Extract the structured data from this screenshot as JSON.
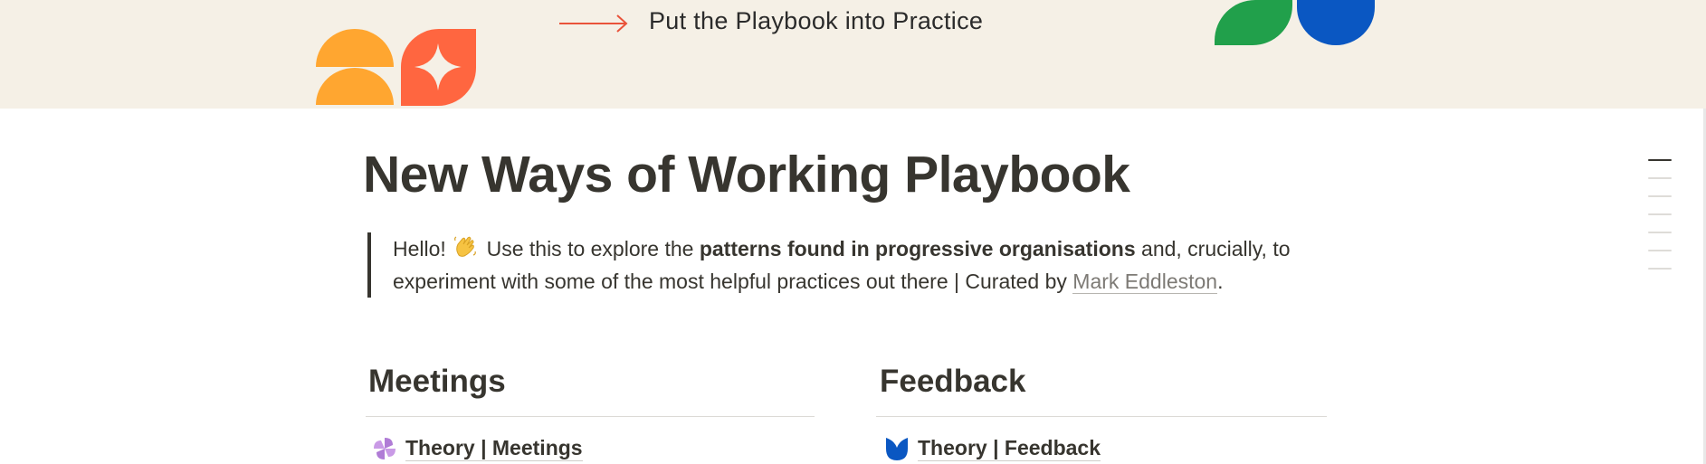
{
  "cover": {
    "cta_text": "Put the Playbook into Practice",
    "colors": {
      "orange": "#ffa630",
      "coral": "#ff6640",
      "green": "#21a04b",
      "blue": "#0a57c2",
      "accent_arrow": "#e9533a",
      "background": "#f5f0e6"
    }
  },
  "page": {
    "title": "New Ways of Working Playbook"
  },
  "intro": {
    "greeting": "Hello!",
    "wave_icon": "waving-hand-icon",
    "text_before": "Use this to explore the",
    "bold_text": "patterns found in progressive organisations",
    "text_after": "and, crucially, to experiment with some of the most helpful practices out there | Curated by",
    "author_link": "Mark Eddleston",
    "end": "."
  },
  "sections": [
    {
      "heading": "Meetings",
      "link_icon": "pinwheel-icon",
      "link_text": "Theory | Meetings",
      "icon_color": "#b07cd6"
    },
    {
      "heading": "Feedback",
      "link_icon": "tulip-icon",
      "link_text": "Theory | Feedback",
      "icon_color": "#0a57c2"
    }
  ],
  "toc": {
    "count": 7,
    "active_index": 0
  }
}
